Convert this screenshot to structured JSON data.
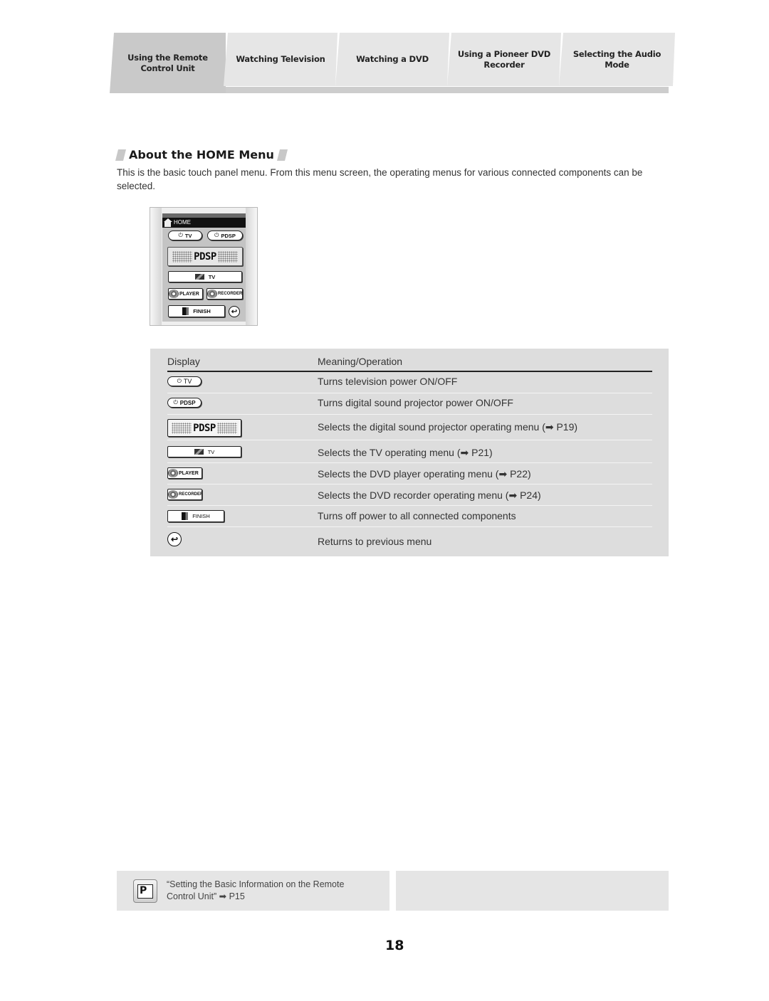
{
  "tabs": [
    {
      "label": "Using the Remote Control Unit",
      "line1": "Using the Remote",
      "line2": "Control Unit",
      "active": true
    },
    {
      "label": "Watching Television",
      "line1": "Watching Television",
      "line2": "",
      "active": false
    },
    {
      "label": "Watching a DVD",
      "line1": "Watching a DVD",
      "line2": "",
      "active": false
    },
    {
      "label": "Using a Pioneer DVD Recorder",
      "line1": "Using a Pioneer DVD",
      "line2": "Recorder",
      "active": false
    },
    {
      "label": "Selecting the Audio Mode",
      "line1": "Selecting the Audio",
      "line2": "Mode",
      "active": false
    }
  ],
  "section": {
    "title": "About the HOME Menu",
    "intro": "This is the basic touch panel menu. From this menu screen, the operating menus for various connected components can be selected."
  },
  "remote_screen": {
    "header": "HOME",
    "buttons": {
      "tv_power": "TV",
      "pdsp_power": "PDSP",
      "pdsp_menu": "PDSP",
      "tv_menu": "TV",
      "player": "PLAYER",
      "recorder": "RECORDER",
      "finish": "FINISH",
      "back": "↩"
    }
  },
  "table": {
    "headers": {
      "display": "Display",
      "meaning": "Meaning/Operation"
    },
    "rows": [
      {
        "display_icon": "tv-power-button-icon",
        "display_label": "TV",
        "meaning": "Turns television power ON/OFF"
      },
      {
        "display_icon": "pdsp-power-button-icon",
        "display_label": "PDSP",
        "meaning": "Turns digital sound projector power ON/OFF"
      },
      {
        "display_icon": "pdsp-menu-button-icon",
        "display_label": "PDSP",
        "meaning": "Selects the digital sound projector operating menu (➡ P19)"
      },
      {
        "display_icon": "tv-menu-button-icon",
        "display_label": "TV",
        "meaning": "Selects the TV operating menu (➡ P21)"
      },
      {
        "display_icon": "dvd-player-button-icon",
        "display_label": "PLAYER",
        "meaning": "Selects the DVD player operating menu (➡ P22)"
      },
      {
        "display_icon": "dvd-recorder-button-icon",
        "display_label": "RECORDER",
        "meaning": "Selects the DVD recorder operating menu (➡ P24)"
      },
      {
        "display_icon": "finish-button-icon",
        "display_label": "FINISH",
        "meaning": "Turns off power to all connected components"
      },
      {
        "display_icon": "back-button-icon",
        "display_label": "↩",
        "meaning": "Returns to previous menu"
      }
    ]
  },
  "footer": {
    "note_icon": "P",
    "note_line1": "“Setting the Basic Information on the Remote",
    "note_line2": "Control Unit” ➡ P15",
    "page_number": "18"
  }
}
